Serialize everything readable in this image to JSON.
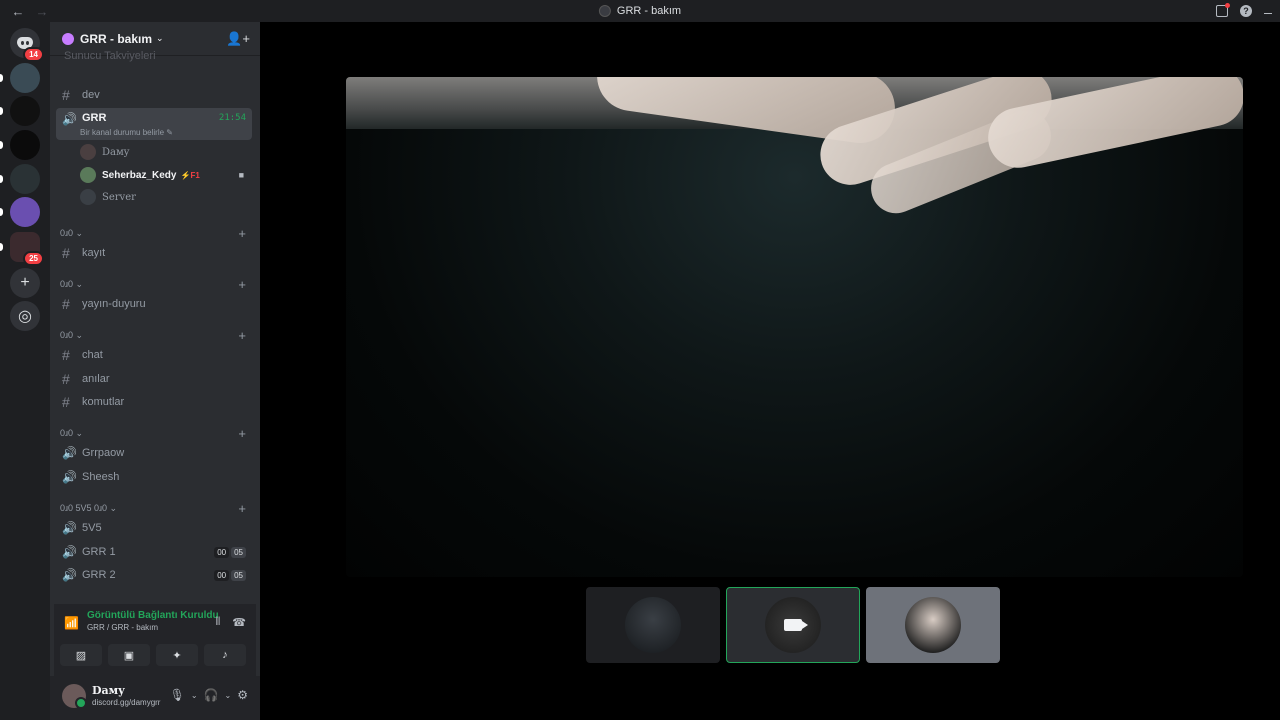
{
  "titlebar": {
    "back": "←",
    "forward": "→",
    "title": "GRR - bakım",
    "help": "?"
  },
  "rail": {
    "home_badge": "14",
    "multi_badge": "25",
    "add": "+",
    "explore": "◎"
  },
  "guild": {
    "name": "GRR - bakım",
    "chevron": "⌄",
    "invite": "👤+"
  },
  "cut_item": "Sunucu Takviyeleri",
  "channels": {
    "dev": "dev",
    "grr": "GRR",
    "grr_time": "21:54",
    "grr_status": "Bir kanal durumu belirle ✎",
    "kayit": "kayıt",
    "yayin": "yayın-duyuru",
    "chat": "chat",
    "anilar": "anılar",
    "komutlar": "komutlar",
    "grrpaow": "Grrpaow",
    "sheesh": "Sheesh",
    "fivev5": "5V5",
    "grr1": "GRR 1",
    "grr2": "GRR 2",
    "count_a": "00",
    "count_b": "05"
  },
  "members": [
    {
      "name": "Dамy"
    },
    {
      "name": "Seherbaz_Kedy",
      "tag": "⚡F1"
    },
    {
      "name": "Server"
    }
  ],
  "categories": {
    "c1": "0ɹ0 ⌄",
    "c2": "0ɹ0 ⌄",
    "c3": "0ɹ0 ⌄",
    "c4": "0ɹ0 ⌄",
    "c5": "0ɹ0 5V5 0ɹ0 ⌄",
    "plus": "+"
  },
  "voice": {
    "title": "Görüntülü Bağlantı Kuruldu",
    "subtitle": "GRR / GRR - bakım"
  },
  "user": {
    "name": "Dамy",
    "status": "discord.gg/damygrr"
  },
  "icons": {
    "back": "arrow-left-icon",
    "forward": "arrow-right-icon",
    "camera": "video-camera-icon",
    "mic": "microphone-icon",
    "headset": "headset-icon",
    "settings": "gear-icon"
  }
}
